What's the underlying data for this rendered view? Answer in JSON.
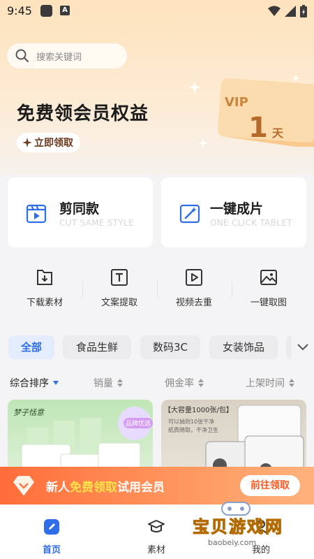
{
  "status_bar": {
    "time": "9:45"
  },
  "search": {
    "placeholder": "搜索关键词"
  },
  "promo": {
    "title": "免费领会员权益",
    "button_label": "立即领取",
    "vip_label": "VIP",
    "vip_days": "1",
    "vip_unit": "天"
  },
  "feature_cards": [
    {
      "title": "剪同款",
      "subtitle": "CUT SAME STYLE",
      "icon": "clapperboard-icon"
    },
    {
      "title": "一键成片",
      "subtitle": "ONE CLICK TABLET",
      "icon": "magic-wand-icon"
    }
  ],
  "tools": [
    {
      "label": "下载素材",
      "icon": "download-file-icon"
    },
    {
      "label": "文案提取",
      "icon": "text-extract-icon"
    },
    {
      "label": "视频去重",
      "icon": "video-play-icon"
    },
    {
      "label": "一键取图",
      "icon": "image-icon"
    }
  ],
  "categories": [
    {
      "label": "全部",
      "active": true
    },
    {
      "label": "食品生鲜",
      "active": false
    },
    {
      "label": "数码3C",
      "active": false
    },
    {
      "label": "女装饰品",
      "active": false
    }
  ],
  "sort_options": [
    {
      "label": "综合排序",
      "active": true
    },
    {
      "label": "销量",
      "active": false
    },
    {
      "label": "佣金率",
      "active": false
    },
    {
      "label": "上架时间",
      "active": false
    }
  ],
  "products": [
    {
      "brand": "梦子恬意",
      "badge": "品牌优选"
    },
    {
      "header": "【大容量1000张/包】",
      "caption": "可以抽到10张干净",
      "caption2": "纸质随取，干净卫生"
    }
  ],
  "banner": {
    "text_prefix": "新人",
    "text_highlight": "免费领取",
    "text_suffix": "试用会员",
    "button_label": "前往领取"
  },
  "tabbar": [
    {
      "label": "首页",
      "icon": "home-pen-icon",
      "active": true
    },
    {
      "label": "素材",
      "icon": "graduation-cap-icon",
      "active": false
    },
    {
      "label": "我的",
      "icon": "user-icon",
      "active": false
    }
  ],
  "watermark": {
    "text": "宝贝游戏网",
    "url": "baobeiy.com"
  },
  "colors": {
    "accent": "#2f6ee8",
    "banner_orange": "#ff6d39",
    "highlight_yellow": "#ffe14a"
  }
}
